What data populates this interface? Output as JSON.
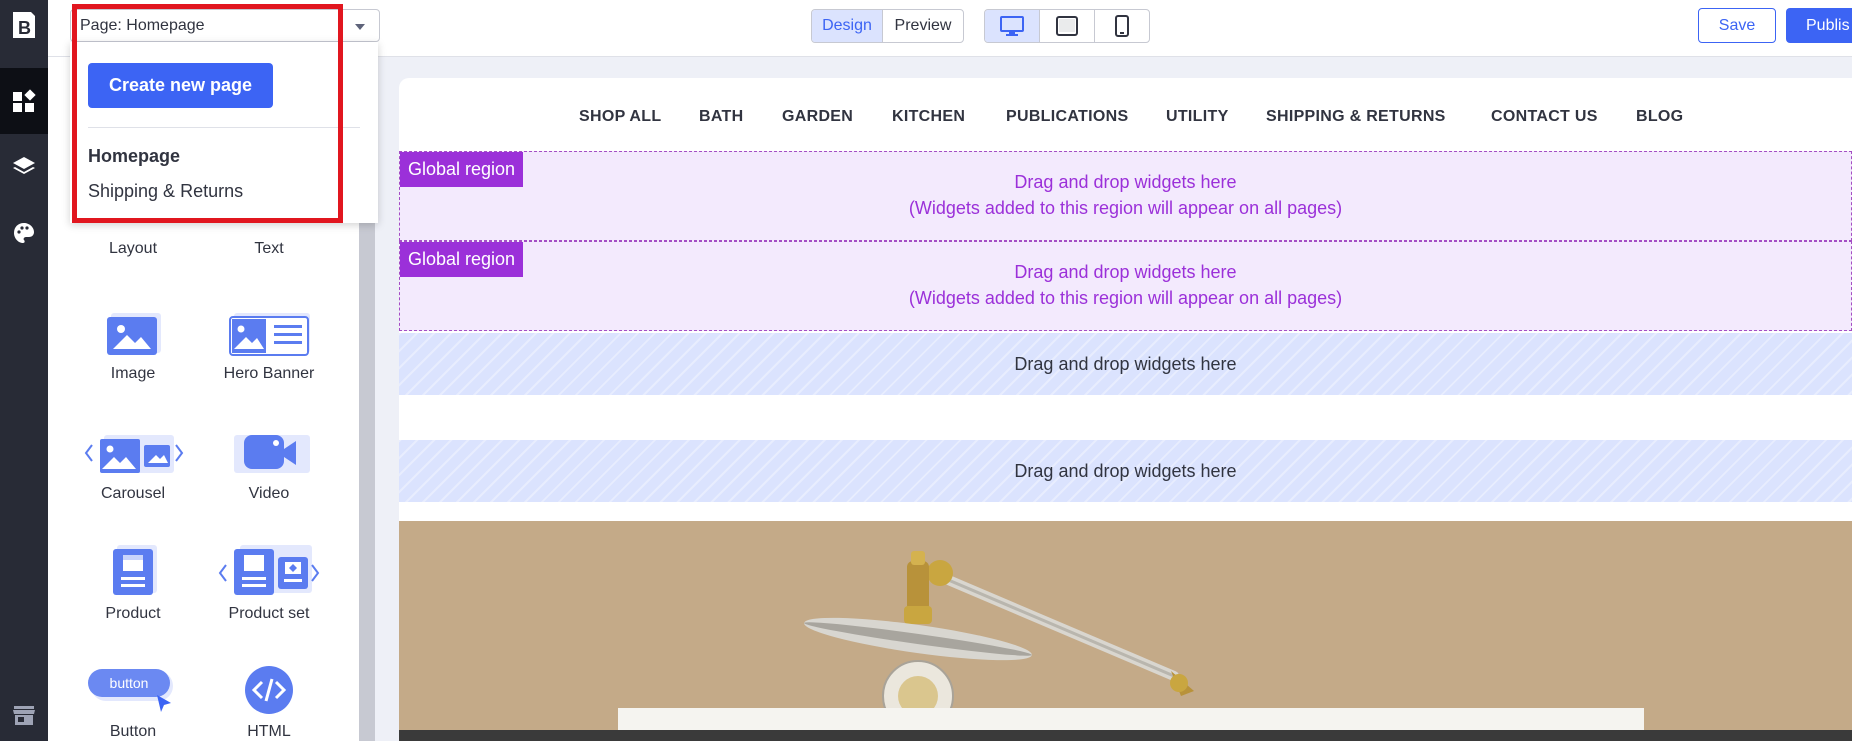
{
  "topbar": {
    "page_selector": "Page: Homepage",
    "mode_tabs": [
      "Design",
      "Preview"
    ],
    "active_mode": "Design",
    "device_icons": [
      "desktop-icon",
      "tablet-icon",
      "mobile-icon"
    ],
    "active_device": "desktop",
    "save_label": "Save",
    "publish_label": "Publis"
  },
  "dropdown": {
    "create_label": "Create new page",
    "pages": [
      "Homepage",
      "Shipping & Returns"
    ],
    "current_page": "Homepage"
  },
  "rail": {
    "icons": [
      "bigcommerce-logo-icon",
      "widgets-icon",
      "layers-icon",
      "palette-icon",
      "storefront-icon"
    ]
  },
  "widgets": [
    {
      "label": "Layout",
      "icon": "layout-icon"
    },
    {
      "label": "Text",
      "icon": "text-icon"
    },
    {
      "label": "Image",
      "icon": "image-icon"
    },
    {
      "label": "Hero Banner",
      "icon": "hero-banner-icon"
    },
    {
      "label": "Carousel",
      "icon": "carousel-icon"
    },
    {
      "label": "Video",
      "icon": "video-icon"
    },
    {
      "label": "Product",
      "icon": "product-icon"
    },
    {
      "label": "Product set",
      "icon": "product-set-icon"
    },
    {
      "label": "Button",
      "icon": "button-icon",
      "icon_text": "button"
    },
    {
      "label": "HTML",
      "icon": "html-icon"
    }
  ],
  "storefront": {
    "nav": [
      "SHOP ALL",
      "BATH",
      "GARDEN",
      "KITCHEN",
      "PUBLICATIONS",
      "UTILITY",
      "SHIPPING & RETURNS",
      "CONTACT US",
      "BLOG"
    ],
    "global_regions": [
      {
        "tag": "Global region",
        "line1": "Drag and drop widgets here",
        "line2": "(Widgets added to this region will appear on all pages)"
      },
      {
        "tag": "Global region",
        "line1": "Drag and drop widgets here",
        "line2": "(Widgets added to this region will appear on all pages)"
      }
    ],
    "dropzones": [
      "Drag and drop widgets here",
      "Drag and drop widgets here"
    ]
  },
  "colors": {
    "accent": "#3c64f4",
    "global_region": "#9b30d9",
    "highlight": "#e1161f",
    "rail": "#282b36",
    "hero_bg": "#c4aa88"
  }
}
